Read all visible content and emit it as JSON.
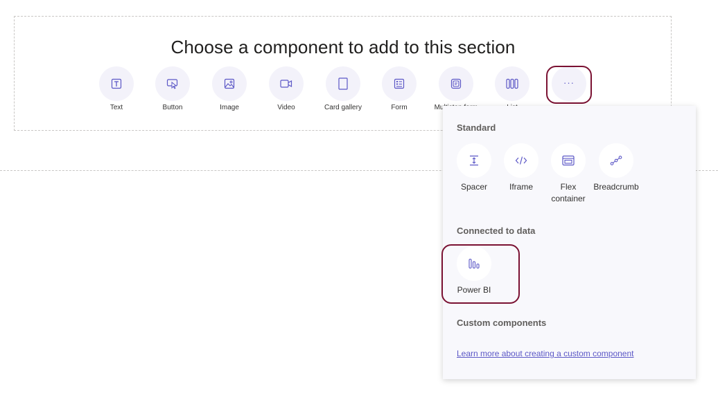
{
  "section": {
    "title": "Choose a component to add to this section"
  },
  "components": [
    {
      "label": "Text",
      "icon": "text-icon"
    },
    {
      "label": "Button",
      "icon": "button-icon"
    },
    {
      "label": "Image",
      "icon": "image-icon"
    },
    {
      "label": "Video",
      "icon": "video-icon"
    },
    {
      "label": "Card gallery",
      "icon": "card-gallery-icon"
    },
    {
      "label": "Form",
      "icon": "form-icon"
    },
    {
      "label": "Multistep form",
      "icon": "multistep-form-icon"
    },
    {
      "label": "List",
      "icon": "list-icon"
    }
  ],
  "more": {
    "icon": "more-icon",
    "glyph": "···"
  },
  "flyout": {
    "standard_heading": "Standard",
    "standard_items": [
      {
        "label": "Spacer",
        "icon": "spacer-icon"
      },
      {
        "label": "Iframe",
        "icon": "iframe-icon"
      },
      {
        "label_line1": "Flex",
        "label_line2": "container",
        "icon": "flex-container-icon"
      },
      {
        "label": "Breadcrumb",
        "icon": "breadcrumb-icon"
      }
    ],
    "data_heading": "Connected to data",
    "data_items": [
      {
        "label": "Power BI",
        "icon": "power-bi-icon"
      }
    ],
    "custom_heading": "Custom components",
    "learn_link": "Learn more about creating a custom component"
  },
  "colors": {
    "accent": "#5b57c6",
    "highlight": "#7a1132",
    "icon_bg": "#f3f2fa",
    "flyout_bg": "#f8f8fc"
  }
}
